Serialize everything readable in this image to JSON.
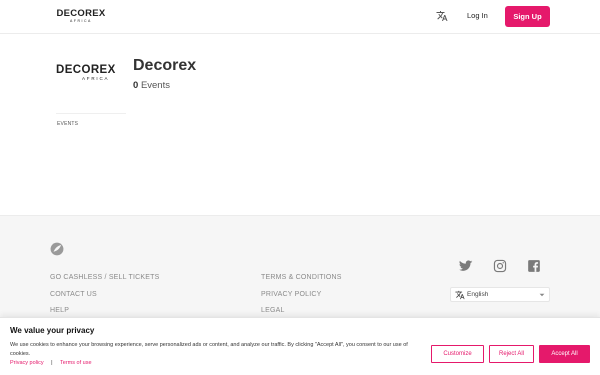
{
  "header": {
    "brand_main": "DECOREX",
    "brand_sub": "AFRICA",
    "language_icon": "translate-icon",
    "login_label": "Log In",
    "signup_label": "Sign Up"
  },
  "profile": {
    "logo_main": "DECOREX",
    "logo_sub": "AFRICA",
    "name": "Decorex",
    "event_count": "0",
    "event_suffix": "Events",
    "tab_label": "EVENTS"
  },
  "footer": {
    "logo_icon": "leaf-logo-icon",
    "left_links": [
      "GO CASHLESS / SELL TICKETS",
      "CONTACT US",
      "HELP"
    ],
    "right_links": [
      "TERMS & CONDITIONS",
      "PRIVACY POLICY",
      "LEGAL"
    ],
    "social": [
      "twitter-icon",
      "instagram-icon",
      "facebook-icon"
    ],
    "language": "English"
  },
  "cookie": {
    "title": "We value your privacy",
    "text": "We use cookies to enhance your browsing experience, serve personalized ads or content, and analyze our traffic. By clicking \"Accept All\", you consent to our use of cookies.",
    "privacy_link": "Privacy policy",
    "separator": "|",
    "terms_link": "Terms of use",
    "customize_label": "Customize",
    "reject_label": "Reject All",
    "accept_label": "Accept All"
  },
  "colors": {
    "accent": "#e5196b",
    "footer_bg": "#f6f6f6",
    "footer_text": "#8a8a8a"
  }
}
